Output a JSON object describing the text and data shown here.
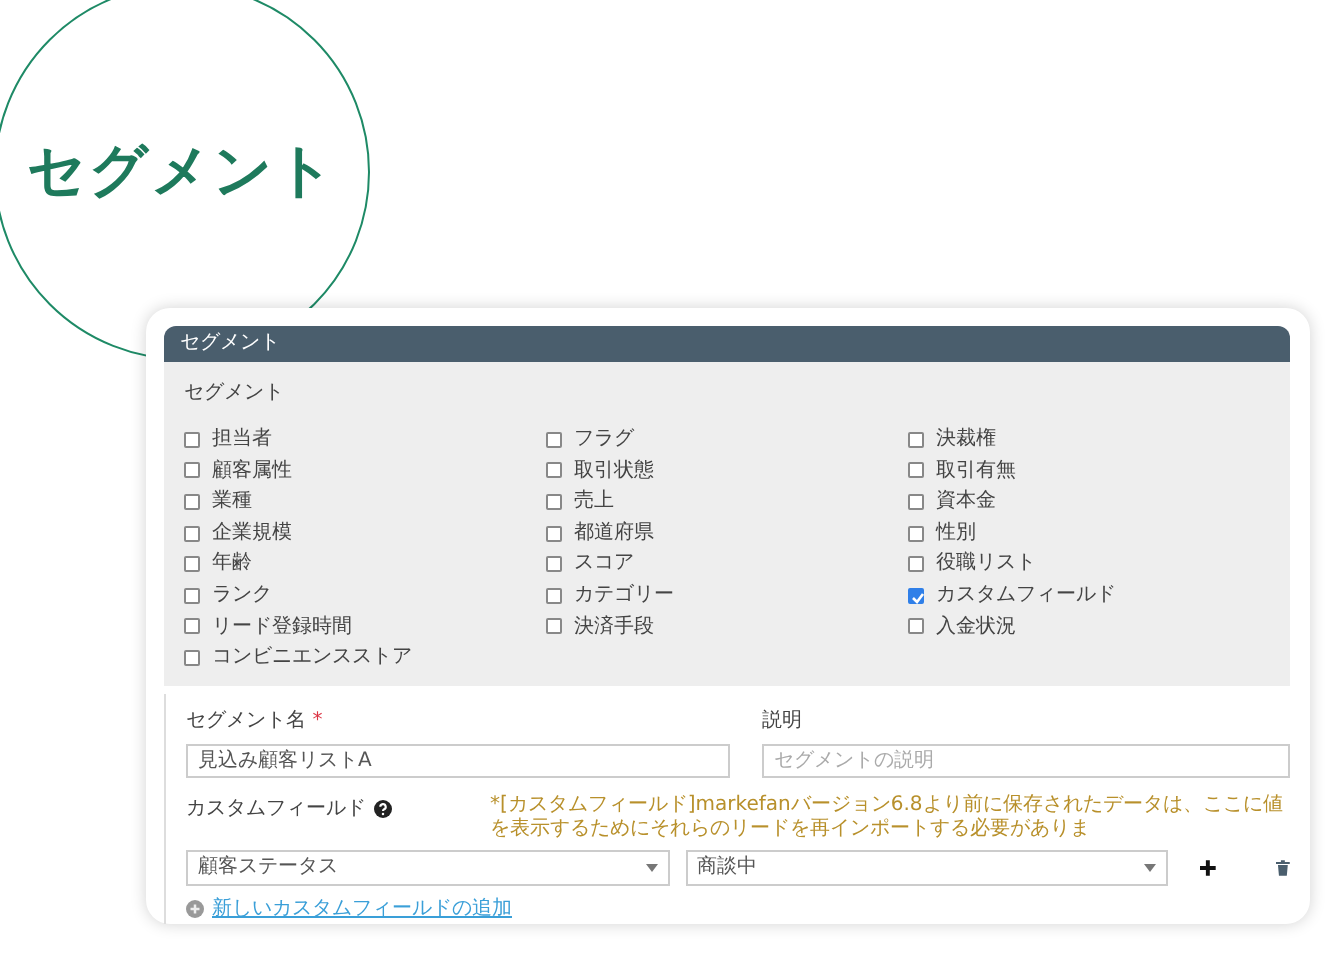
{
  "badge": {
    "title": "セグメント"
  },
  "panel": {
    "title": "セグメント",
    "section_label": "セグメント",
    "checkboxes": [
      {
        "label": "担当者",
        "checked": false
      },
      {
        "label": "フラグ",
        "checked": false
      },
      {
        "label": "決裁権",
        "checked": false
      },
      {
        "label": "顧客属性",
        "checked": false
      },
      {
        "label": "取引状態",
        "checked": false
      },
      {
        "label": "取引有無",
        "checked": false
      },
      {
        "label": "業種",
        "checked": false
      },
      {
        "label": "売上",
        "checked": false
      },
      {
        "label": "資本金",
        "checked": false
      },
      {
        "label": "企業規模",
        "checked": false
      },
      {
        "label": "都道府県",
        "checked": false
      },
      {
        "label": "性別",
        "checked": false
      },
      {
        "label": "年齢",
        "checked": false
      },
      {
        "label": "スコア",
        "checked": false
      },
      {
        "label": "役職リスト",
        "checked": false
      },
      {
        "label": "ランク",
        "checked": false
      },
      {
        "label": "カテゴリー",
        "checked": false
      },
      {
        "label": "カスタムフィールド",
        "checked": true
      },
      {
        "label": "リード登録時間",
        "checked": false
      },
      {
        "label": "決済手段",
        "checked": false
      },
      {
        "label": "入金状況",
        "checked": false
      },
      {
        "label": "コンビニエンスストア",
        "checked": false
      }
    ]
  },
  "form": {
    "name_label": "セグメント名",
    "required_mark": "*",
    "name_value": "見込み顧客リストA",
    "description_label": "説明",
    "description_placeholder": "セグメントの説明",
    "custom_field_label": "カスタムフィールド",
    "custom_field_note": "*[カスタムフィールド]markefanバージョン6.8より前に保存されたデータは、ここに値を表示するためにそれらのリードを再インポートする必要がありま",
    "custom_fields": [
      {
        "field": "顧客ステータス",
        "value": "商談中"
      }
    ],
    "add_link": "新しいカスタムフィールドの追加"
  }
}
